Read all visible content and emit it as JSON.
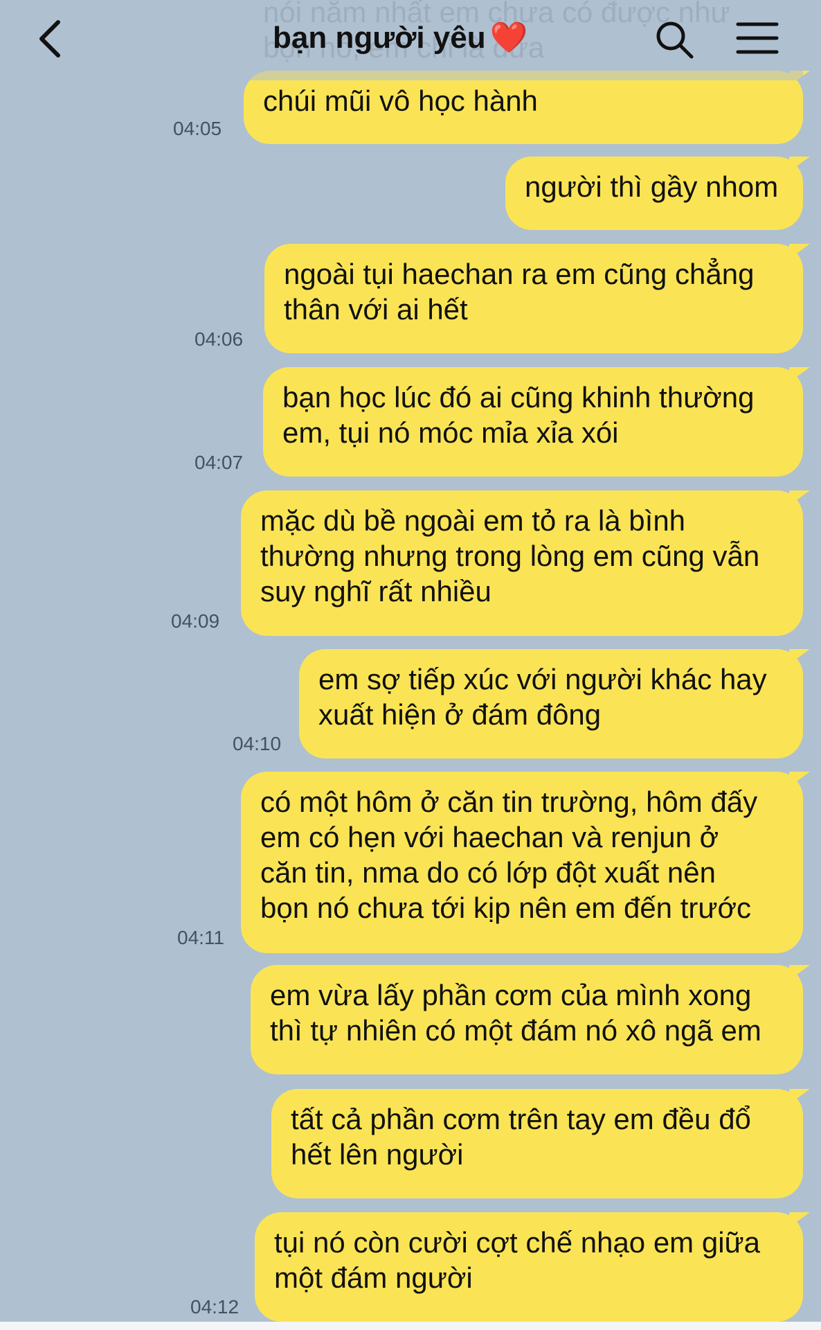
{
  "header": {
    "title": "bạn người yêu",
    "title_emoji": "❤️",
    "back_icon": "chevron-left-icon",
    "search_icon": "search-icon",
    "menu_icon": "hamburger-menu-icon"
  },
  "overflow_text": "nói nằm nhất em chưa có được như\nbọn nó, em chỉ là đứa\nmọt sách, đeo cặp kính cận suốt ngày",
  "messages": [
    {
      "text": "chúi mũi vô học hành",
      "time": "04:05"
    },
    {
      "text": "người thì gầy nhom",
      "time": ""
    },
    {
      "text": "ngoài tụi haechan ra em cũng chẳng\nthân với ai hết",
      "time": "04:06"
    },
    {
      "text": "bạn học lúc đó ai cũng khinh thường\nem, tụi nó móc mỉa xỉa xói",
      "time": "04:07"
    },
    {
      "text": "mặc dù bề ngoài em tỏ ra là bình\nthường nhưng trong lòng em cũng vẫn\nsuy nghĩ rất nhiều",
      "time": "04:09"
    },
    {
      "text": "em sợ tiếp xúc với người khác hay\nxuất hiện ở đám đông",
      "time": "04:10"
    },
    {
      "text": "có một hôm ở căn tin trường, hôm đấy\nem có hẹn với haechan và renjun ở\ncăn tin, nma do có lớp đột xuất nên\nbọn nó chưa tới kịp nên em đến trước",
      "time": "04:11"
    },
    {
      "text": "em vừa lấy phần cơm của mình xong\nthì tự nhiên có một đám nó xô ngã em",
      "time": ""
    },
    {
      "text": "tất cả phần cơm trên tay em đều đổ\nhết lên người",
      "time": ""
    },
    {
      "text": "tụi nó còn cười cợt chế nhạo em giữa\nmột đám người",
      "time": "04:12"
    }
  ],
  "colors": {
    "background": "#afc0d1",
    "bubble": "#fae455",
    "heart": "#e0242f"
  }
}
